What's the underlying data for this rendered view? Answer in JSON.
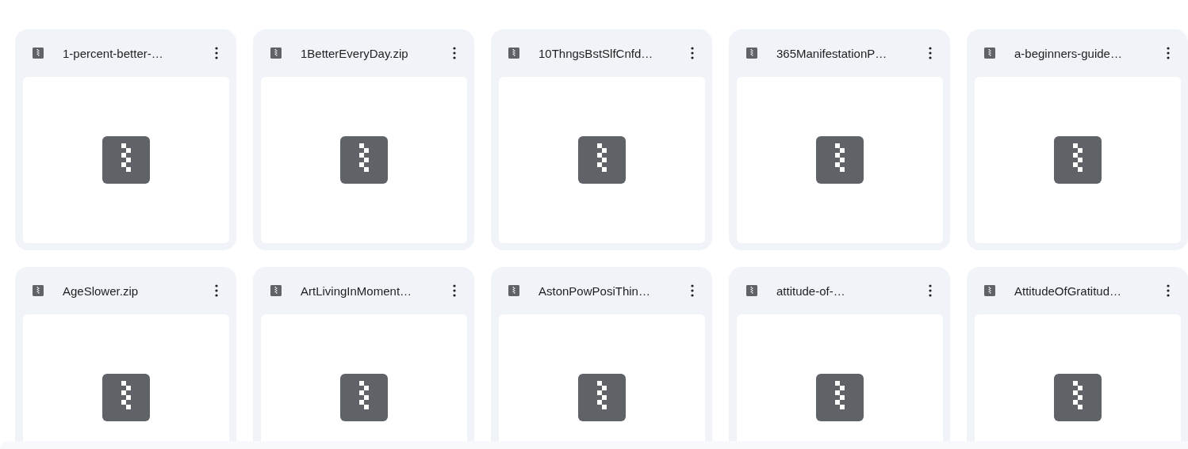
{
  "files": [
    {
      "name": "1-percent-better-…"
    },
    {
      "name": "1BetterEveryDay.zip"
    },
    {
      "name": "10ThngsBstSlfCnfd…"
    },
    {
      "name": "365ManifestationP…"
    },
    {
      "name": "a-beginners-guide…"
    },
    {
      "name": "AgeSlower.zip"
    },
    {
      "name": "ArtLivingInMoment…"
    },
    {
      "name": "AstonPowPosiThin…"
    },
    {
      "name": "attitude-of-…"
    },
    {
      "name": "AttitudeOfGratitud…"
    }
  ]
}
